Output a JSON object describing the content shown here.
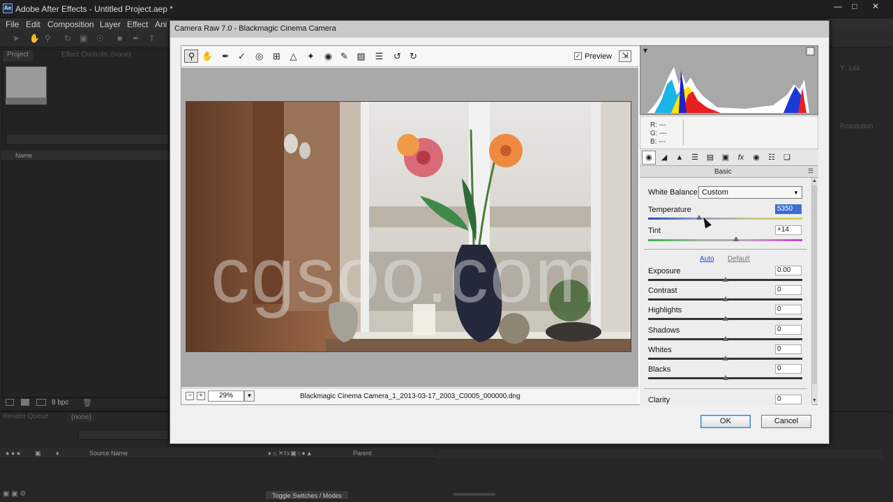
{
  "app": {
    "title": "Adobe After Effects - Untitled Project.aep *",
    "logo": "Ae",
    "menus": [
      "File",
      "Edit",
      "Composition",
      "Layer",
      "Effect",
      "Ani"
    ],
    "window_controls": [
      "minimize-icon",
      "maximize-icon",
      "close-icon"
    ]
  },
  "project_panel": {
    "tab": "Project",
    "effect_controls_tab": "Effect Controls: (none)",
    "column_name": "Name",
    "bit_depth": "8 bpc"
  },
  "timeline": {
    "render_queue_tab": "Render Queue",
    "none_tab": "(none)",
    "source_name_col": "Source Name",
    "parent_col": "Parent",
    "toggle_label": "Toggle Switches / Modes"
  },
  "right_panels": {
    "resolution_label": "Resolution",
    "y_readout": "Y: 144"
  },
  "dialog": {
    "title": "Camera Raw 7.0  -  Blackmagic Cinema Camera",
    "preview_label": "Preview",
    "preview_checked": "✓",
    "zoom_value": "29%",
    "filename": "Blackmagic Cinema Camera_1_2013-03-17_2003_C0005_000000.dng",
    "watermark": "cgsoo.com",
    "rgb": {
      "r": "R:  ---",
      "g": "G:  ---",
      "b": "B:  ---"
    },
    "panel_title": "Basic",
    "white_balance": {
      "label": "White Balance:",
      "value": "Custom"
    },
    "auto_label": "Auto",
    "default_label": "Default",
    "sliders": [
      {
        "label": "Temperature",
        "value": "5350",
        "level": 0.33
      },
      {
        "label": "Tint",
        "value": "+14",
        "level": 0.57
      },
      {
        "label": "Exposure",
        "value": "0.00",
        "level": 0.5
      },
      {
        "label": "Contrast",
        "value": "0",
        "level": 0.5
      },
      {
        "label": "Highlights",
        "value": "0",
        "level": 0.5
      },
      {
        "label": "Shadows",
        "value": "0",
        "level": 0.5
      },
      {
        "label": "Whites",
        "value": "0",
        "level": 0.5
      },
      {
        "label": "Blacks",
        "value": "0",
        "level": 0.5
      },
      {
        "label": "Clarity",
        "value": "0",
        "level": 0.5
      }
    ],
    "ok_label": "OK",
    "cancel_label": "Cancel",
    "tools": [
      "zoom-icon",
      "hand-icon",
      "white-balance-icon",
      "color-sampler-icon",
      "target-adjust-icon",
      "crop-icon",
      "straighten-icon",
      "spot-removal-icon",
      "red-eye-icon",
      "adjustment-brush-icon",
      "graduated-filter-icon",
      "preferences-icon",
      "rotate-ccw-icon",
      "rotate-cw-icon"
    ],
    "panel_tab_icons": [
      "basic-icon",
      "tone-curve-icon",
      "detail-icon",
      "hsl-icon",
      "split-toning-icon",
      "lens-corrections-icon",
      "effects-icon",
      "camera-calibration-icon",
      "presets-icon",
      "snapshots-icon"
    ]
  }
}
